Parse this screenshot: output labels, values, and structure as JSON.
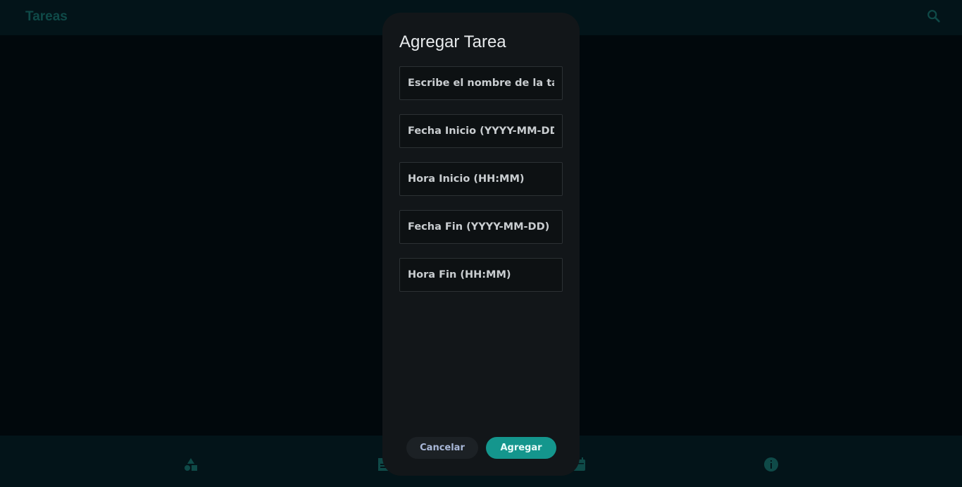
{
  "app": {
    "title": "Tareas"
  },
  "topbar": {
    "search_icon": "search-icon"
  },
  "bottom_nav": {
    "icons": [
      "shapes-icon",
      "notes-icon",
      "calendar-icon",
      "info-icon"
    ]
  },
  "dialog": {
    "title": "Agregar Tarea",
    "fields": [
      {
        "name": "task-name-field",
        "value": "",
        "placeholder": "Escribe el nombre de la ta..."
      },
      {
        "name": "start-date-field",
        "value": "",
        "placeholder": "Fecha Inicio (YYYY-MM-DD)"
      },
      {
        "name": "start-time-field",
        "value": "",
        "placeholder": "Hora Inicio (HH:MM)"
      },
      {
        "name": "end-date-field",
        "value": "",
        "placeholder": "Fecha Fin (YYYY-MM-DD)"
      },
      {
        "name": "end-time-field",
        "value": "",
        "placeholder": "Hora Fin (HH:MM)"
      }
    ],
    "cancel_label": "Cancelar",
    "submit_label": "Agregar"
  },
  "colors": {
    "accent": "#14968d",
    "header_title": "#0f4a48",
    "background": "#01080c",
    "bars": "#031419",
    "dialog": "#121619"
  }
}
